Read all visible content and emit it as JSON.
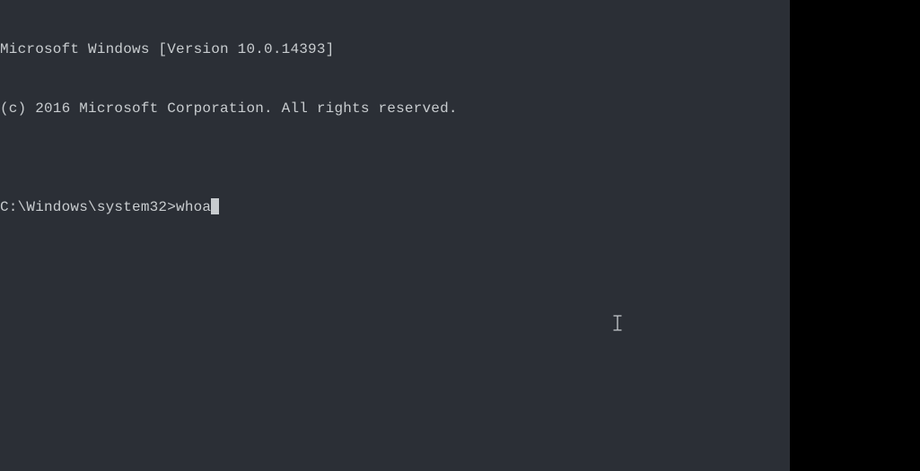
{
  "terminal": {
    "banner_line1": "Microsoft Windows [Version 10.0.14393]",
    "banner_line2": "(c) 2016 Microsoft Corporation. All rights reserved.",
    "blank_line": "",
    "prompt": "C:\\Windows\\system32>",
    "typed_command": "whoa"
  }
}
